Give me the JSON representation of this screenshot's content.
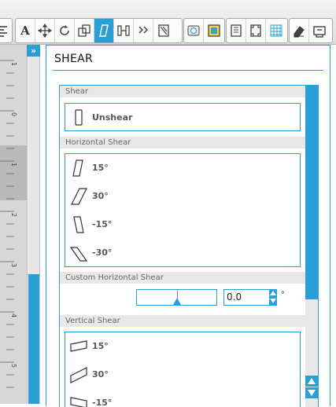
{
  "toolbar": {
    "groups": [
      {
        "buttons": [
          "align-left-icon"
        ]
      },
      {
        "buttons": [
          "text-icon",
          "move-icon",
          "rotate-icon",
          "scale-icon",
          "shear-icon",
          "distribute-icon",
          "replicate-icon",
          "weld-icon"
        ],
        "active": "shear-icon"
      },
      {
        "buttons": [
          "library-icon",
          "fill-icon"
        ]
      },
      {
        "buttons": [
          "page-setup-icon",
          "registration-icon",
          "grid-icon"
        ]
      },
      {
        "buttons": [
          "eraser-icon",
          "send-icon"
        ]
      }
    ],
    "text_glyph": "A"
  },
  "ruler": {
    "numbers": [
      "1",
      "0",
      "1",
      "2",
      "3",
      "4",
      "5"
    ]
  },
  "panel": {
    "title": "SHEAR",
    "sections": {
      "shear": {
        "header": "Shear",
        "items": [
          {
            "label": "Unshear",
            "icon": "unshear-icon"
          }
        ]
      },
      "horizontal": {
        "header": "Horizontal Shear",
        "items": [
          {
            "label": "15°",
            "icon": "h-shear-15-icon"
          },
          {
            "label": "30°",
            "icon": "h-shear-30-icon"
          },
          {
            "label": "-15°",
            "icon": "h-shear-neg15-icon"
          },
          {
            "label": "-30°",
            "icon": "h-shear-neg30-icon"
          }
        ]
      },
      "custom_horizontal": {
        "header": "Custom Horizontal Shear",
        "value": "0.0",
        "unit": "°"
      },
      "vertical": {
        "header": "Vertical Shear",
        "items": [
          {
            "label": "15°",
            "icon": "v-shear-15-icon"
          },
          {
            "label": "30°",
            "icon": "v-shear-30-icon"
          },
          {
            "label": "-15°",
            "icon": "v-shear-neg15-icon"
          }
        ]
      }
    }
  },
  "colors": {
    "accent": "#2a9fd6",
    "section_header_bg": "#e8e8e8",
    "ruler_bg": "#d8d8d8"
  }
}
